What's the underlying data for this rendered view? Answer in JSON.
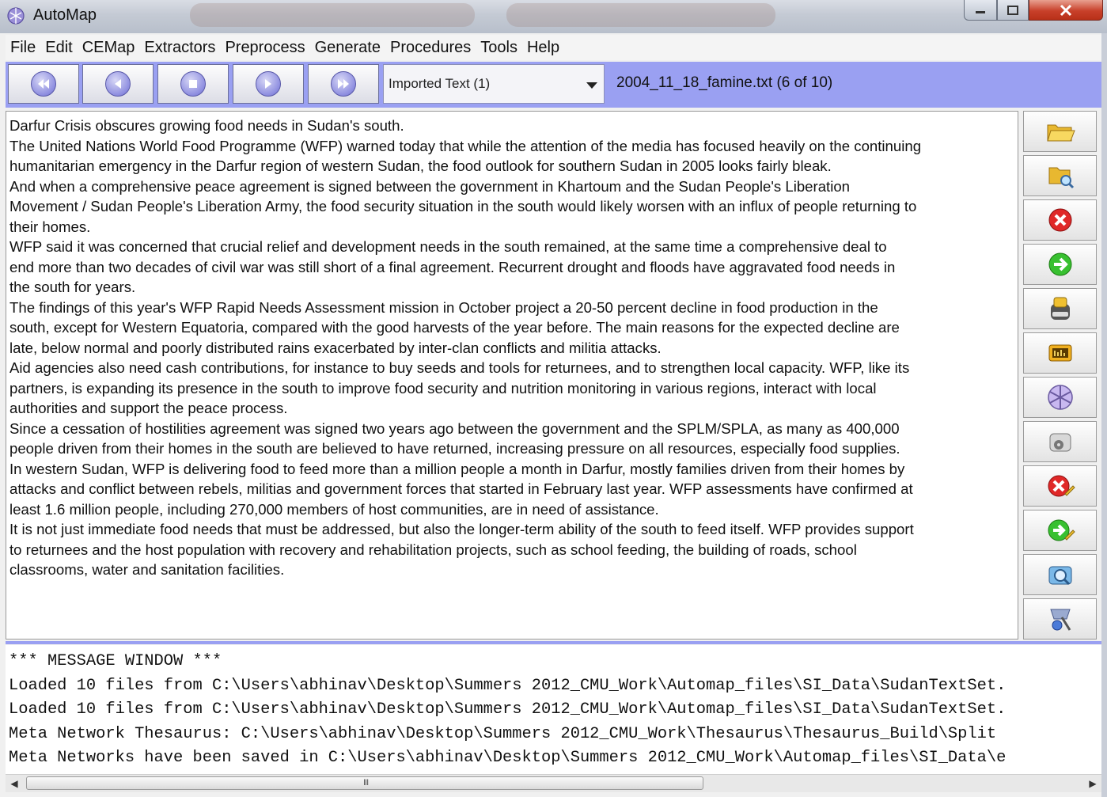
{
  "window": {
    "title": "AutoMap",
    "controls": [
      "minimize",
      "maximize",
      "close"
    ]
  },
  "menu": [
    "File",
    "Edit",
    "CEMap",
    "Extractors",
    "Preprocess",
    "Generate",
    "Procedures",
    "Tools",
    "Help"
  ],
  "toolbar": {
    "nav_buttons": [
      "first-icon",
      "previous-icon",
      "stop-icon",
      "next-icon",
      "last-icon"
    ],
    "view_select": "Imported Text (1)",
    "file_status": "2004_11_18_famine.txt   (6 of 10)"
  },
  "document": {
    "lines": [
      "Darfur Crisis obscures growing food needs in Sudan's south.",
      "The United Nations World Food Programme (WFP) warned today that while the attention of the media has focused heavily on the continuing",
      "humanitarian emergency in the Darfur region of western Sudan, the food outlook for southern Sudan in 2005 looks fairly bleak.",
      "And when a comprehensive peace agreement is signed between the government in Khartoum and the Sudan People's Liberation",
      "Movement / Sudan People's Liberation Army, the food security situation in the south would likely worsen with an influx of people returning to",
      "their homes.",
      "WFP said it was concerned that crucial relief and development needs in the south remained, at the same time a comprehensive deal to",
      "end more than two decades of civil war was still short of a final agreement. Recurrent drought and floods have aggravated food needs in",
      "the south for years.",
      "The findings of this year's WFP Rapid Needs Assessment mission in October project a 20-50 percent decline in food production in the",
      "south, except for Western Equatoria, compared with the good harvests of the year before. The main reasons for the expected decline are",
      "late, below normal and poorly distributed rains exacerbated by inter-clan conflicts and militia attacks.",
      "Aid agencies also need cash contributions, for instance to buy seeds and tools for returnees, and to strengthen local capacity. WFP, like its",
      "partners, is expanding its presence in the south to improve food security and nutrition monitoring in various regions, interact with local",
      "authorities and support the peace process.",
      "Since a cessation of hostilities agreement was signed two years ago between the government and the SPLM/SPLA, as many as 400,000",
      "people driven from their homes in the south are believed to have returned, increasing pressure on all resources, especially food supplies.",
      "In western Sudan, WFP is delivering food to feed more than a million people a month in Darfur, mostly families driven from their homes by",
      "attacks and conflict between rebels, militias and government forces that started in February last year. WFP assessments have confirmed at",
      "least 1.6 million people, including 270,000 members of host communities, are in need of assistance.",
      "It is not just immediate food needs that must be addressed, but also the longer-term ability of the south to feed itself. WFP provides support",
      "to returnees and the host population with recovery and rehabilitation projects, such as school feeding, the building of roads, school",
      "classrooms, water and sanitation facilities."
    ]
  },
  "sidebar": {
    "buttons": [
      "open-folder-icon",
      "search-folder-icon",
      "delete-icon",
      "forward-icon",
      "save-icon",
      "display-icon",
      "network-icon",
      "settings-disk-icon",
      "edit-delete-icon",
      "edit-forward-icon",
      "image-search-icon",
      "tools-icon"
    ]
  },
  "messages": {
    "lines": [
      "*** MESSAGE WINDOW ***",
      "Loaded 10 files from C:\\Users\\abhinav\\Desktop\\Summers 2012_CMU_Work\\Automap_files\\SI_Data\\SudanTextSet.",
      "Loaded 10 files from C:\\Users\\abhinav\\Desktop\\Summers 2012_CMU_Work\\Automap_files\\SI_Data\\SudanTextSet.",
      "Meta Network Thesaurus: C:\\Users\\abhinav\\Desktop\\Summers 2012_CMU_Work\\Thesaurus\\Thesaurus_Build\\Split",
      "Meta Networks have been saved in C:\\Users\\abhinav\\Desktop\\Summers 2012_CMU_Work\\Automap_files\\SI_Data\\e"
    ]
  },
  "scrollbar": {
    "grip": "III",
    "left_arrow": "◀",
    "right_arrow": "▶",
    "position": 0.62
  },
  "colors": {
    "toolbar": "#9aa0f2",
    "close_button": "#c8402a"
  }
}
